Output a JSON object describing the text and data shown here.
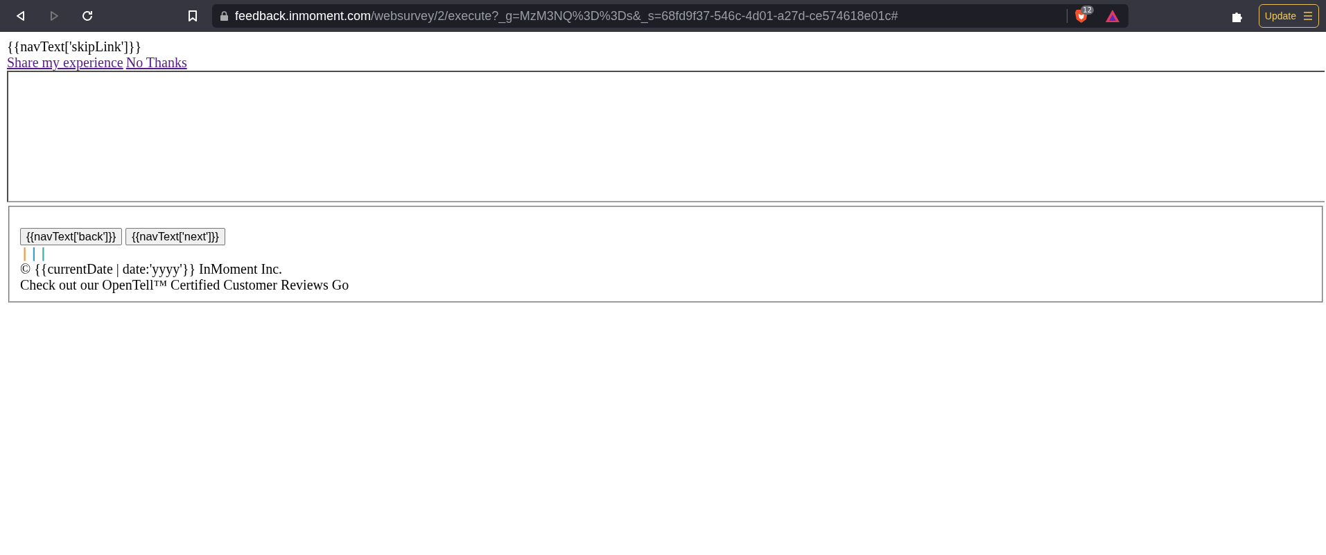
{
  "browser": {
    "url_host": "feedback.inmoment.com",
    "url_path": "/websurvey/2/execute?_g=MzM3NQ%3D%3Ds&_s=68fd9f37-546c-4d01-a27d-ce574618e01c#",
    "shield_count": "12",
    "update_label": "Update"
  },
  "page": {
    "skip_text": "{{navText['skipLink']}}",
    "links": [
      "Share my experience",
      "No Thanks"
    ],
    "buttons": [
      "{{navText['back']}}",
      "{{navText['next']}}"
    ],
    "separators": [
      {
        "text": "|",
        "color": "#e8a040"
      },
      {
        "text": "|",
        "color": "#3aa0d0"
      },
      {
        "text": "|",
        "color": "#40b0a0"
      }
    ],
    "copyright": "© {{currentDate | date:'yyyy'}} InMoment Inc.",
    "reviews_text": "Check out our OpenTell™ Certified Customer Reviews Go"
  }
}
